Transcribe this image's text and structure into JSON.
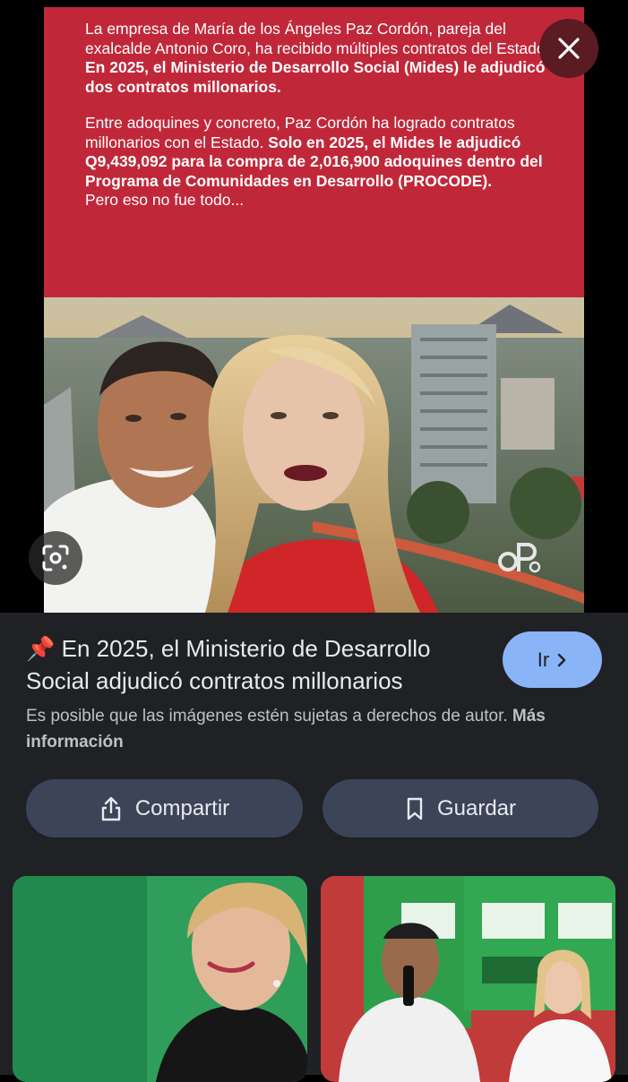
{
  "viewer": {
    "paragraph1_plain": "La empresa de María de los Ángeles Paz Cordón, pareja del exalcalde Antonio Coro, ha recibido múltiples contratos del Estado.",
    "paragraph1_bold": "En 2025, el Ministerio de Desarrollo Social (Mides) le adjudicó dos contratos millonarios.",
    "paragraph2_plain": "Entre adoquines y concreto, Paz Cordón ha logrado contratos millonarios con el Estado.",
    "paragraph2_bold": "Solo en 2025, el Mides le adjudicó Q9,439,092 para la compra de 2,016,900 adoquines dentro del Programa de Comunidades en Desarrollo (PROCODE).",
    "paragraph2_tail": "Pero eso no fue todo...",
    "panel_color": "#c0283a"
  },
  "result": {
    "pin_emoji": "📌",
    "title": "En 2025, el Ministerio de Desarrollo Social adjudicó contratos millonarios",
    "go_label": "Ir",
    "notice_text": "Es posible que las imágenes estén sujetas a derechos de autor.",
    "more_info_label": "Más información"
  },
  "actions": {
    "share_label": "Compartir",
    "save_label": "Guardar"
  },
  "colors": {
    "accent": "#8ab4f8",
    "button_bg": "#3c4458",
    "panel_bg": "#202124"
  }
}
